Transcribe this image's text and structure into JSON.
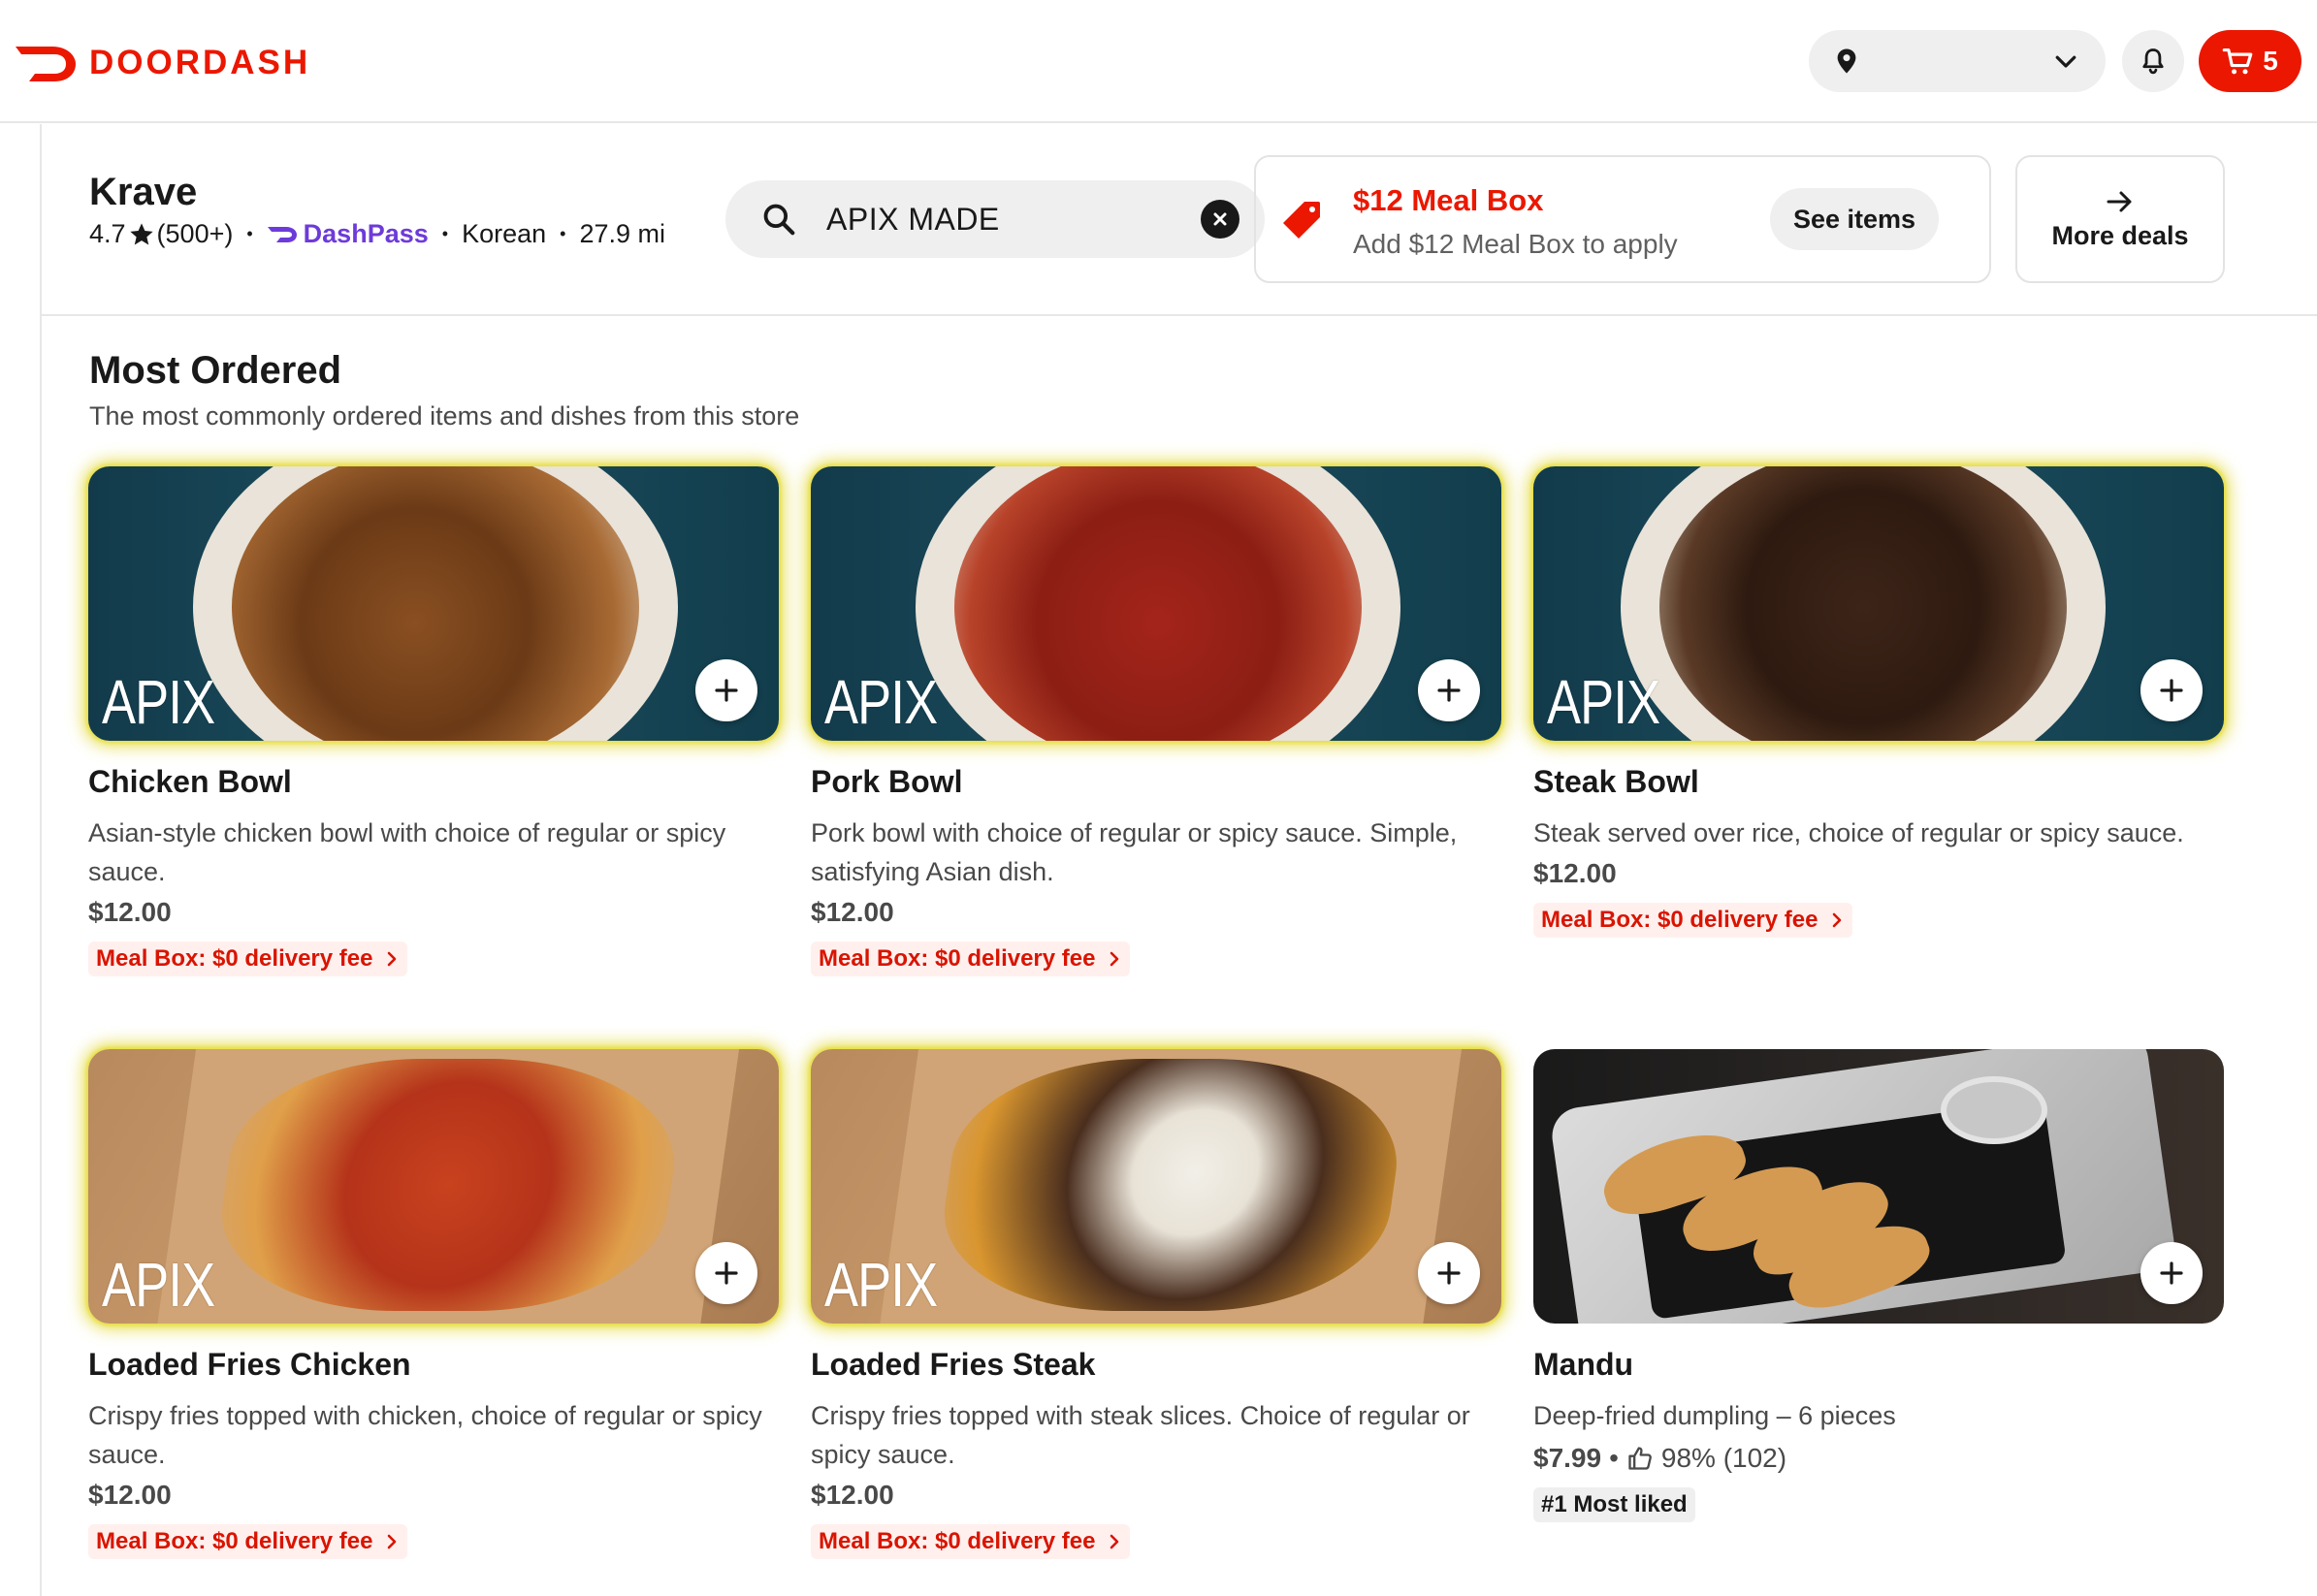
{
  "brand": {
    "name": "DOORDASH",
    "accent": "#eb1700"
  },
  "header": {
    "cart_count": "5"
  },
  "store": {
    "name": "Krave",
    "rating": "4.7",
    "reviews": "(500+)",
    "dashpass": "DashPass",
    "cuisine": "Korean",
    "distance": "27.9 mi"
  },
  "search": {
    "value": "APIX MADE"
  },
  "deal": {
    "title": "$12 Meal Box",
    "subtitle": "Add $12 Meal Box to apply",
    "button": "See items"
  },
  "more_deals": "More deals",
  "section": {
    "title": "Most Ordered",
    "subtitle": "The most commonly ordered items and dishes from this store"
  },
  "items": [
    {
      "name": "Chicken Bowl",
      "description": "Asian-style chicken bowl with choice of regular or spicy sauce.",
      "price": "$12.00",
      "badge": "Meal Box: $0 delivery fee",
      "watermark": "APIX"
    },
    {
      "name": "Pork Bowl",
      "description": "Pork bowl with choice of regular or spicy sauce. Simple, satisfying Asian dish.",
      "price": "$12.00",
      "badge": "Meal Box: $0 delivery fee",
      "watermark": "APIX"
    },
    {
      "name": "Steak Bowl",
      "description": "Steak served over rice, choice of regular or spicy sauce.",
      "price": "$12.00",
      "badge": "Meal Box: $0 delivery fee",
      "watermark": "APIX"
    },
    {
      "name": "Loaded Fries Chicken",
      "description": "Crispy fries topped with chicken, choice of regular or spicy sauce.",
      "price": "$12.00",
      "badge": "Meal Box: $0 delivery fee",
      "watermark": "APIX"
    },
    {
      "name": "Loaded Fries Steak",
      "description": "Crispy fries topped with steak slices. Choice of regular or spicy sauce.",
      "price": "$12.00",
      "badge": "Meal Box: $0 delivery fee",
      "watermark": "APIX"
    },
    {
      "name": "Mandu",
      "description": "Deep-fried dumpling – 6 pieces",
      "price": "$7.99",
      "rating": "98% (102)",
      "badge": "#1 Most liked"
    }
  ]
}
